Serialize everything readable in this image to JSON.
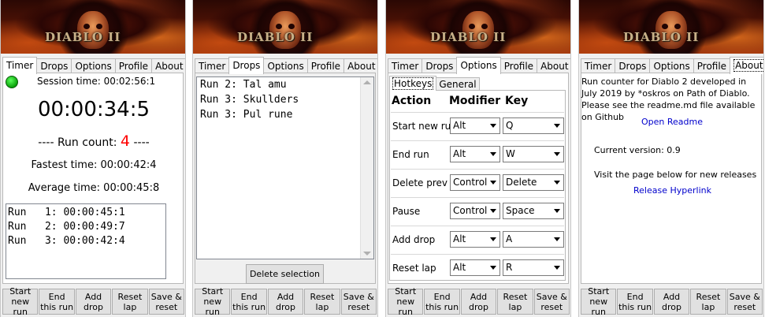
{
  "logo_text": "DIABLO II",
  "tabs": [
    "Timer",
    "Drops",
    "Options",
    "Profile",
    "About"
  ],
  "bottom_buttons": [
    "Start\nnew run",
    "End\nthis run",
    "Add\ndrop",
    "Reset\nlap",
    "Save &\nreset"
  ],
  "timer": {
    "session_label": "Session time: 00:02:56:1",
    "current_time": "00:00:34:5",
    "run_count_prefix": "---- Run count:",
    "run_count": "4",
    "run_count_suffix": "----",
    "fastest": "Fastest time: 00:00:42:4",
    "average": "Average time: 00:00:45:8",
    "runs": [
      "Run   1: 00:00:45:1",
      "Run   2: 00:00:49:7",
      "Run   3: 00:00:42:4"
    ]
  },
  "drops": {
    "items": [
      "Run 2: Tal amu",
      "Run 3: Skullders",
      "Run 3: Pul rune"
    ],
    "delete_label": "Delete selection"
  },
  "options": {
    "subtabs": [
      "Hotkeys",
      "General"
    ],
    "headers": {
      "action": "Action",
      "modifier": "Modifier",
      "key": "Key"
    },
    "hotkeys": [
      {
        "action": "Start new run",
        "modifier": "Alt",
        "key": "Q"
      },
      {
        "action": "End run",
        "modifier": "Alt",
        "key": "W"
      },
      {
        "action": "Delete prev",
        "modifier": "Control",
        "key": "Delete"
      },
      {
        "action": "Pause",
        "modifier": "Control",
        "key": "Space"
      },
      {
        "action": "Add drop",
        "modifier": "Alt",
        "key": "A"
      },
      {
        "action": "Reset lap",
        "modifier": "Alt",
        "key": "R"
      }
    ]
  },
  "about": {
    "description": "Run counter for Diablo 2 developed in July 2019 by *oskros on Path of Diablo. Please see the readme.md file available on Github",
    "readme_link": "Open Readme",
    "version": "Current version: 0.9",
    "visit_text": "Visit the page below for new releases",
    "release_link": "Release Hyperlink"
  },
  "colors": {
    "run_count": "#ff0000",
    "link": "#0000cc",
    "led": "#0aa00a"
  },
  "active_tabs": [
    "Timer",
    "Drops",
    "Options",
    "About"
  ]
}
